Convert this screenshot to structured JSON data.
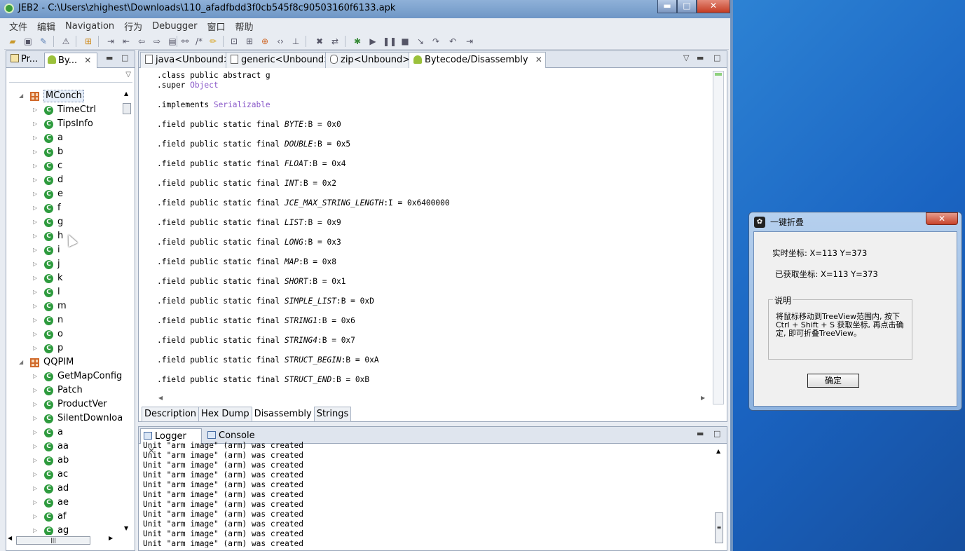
{
  "window": {
    "title": "JEB2 - C:\\Users\\zhighest\\Downloads\\110_afadfbdd3f0cb545f8c90503160f6133.apk",
    "minimize": "▬",
    "maximize": "□",
    "close": "✕"
  },
  "menu": [
    "文件",
    "编辑",
    "Navigation",
    "行为",
    "Debugger",
    "窗口",
    "帮助"
  ],
  "left_panel": {
    "tabs": [
      {
        "label": "Pr...",
        "icon": "project-icon"
      },
      {
        "label": "By...",
        "icon": "android-icon",
        "close": "✕"
      }
    ],
    "tree": [
      {
        "type": "package",
        "label": "MConch",
        "expanded": true,
        "selected": true
      },
      {
        "type": "class",
        "label": "TimeCtrl"
      },
      {
        "type": "class",
        "label": "TipsInfo"
      },
      {
        "type": "class",
        "label": "a"
      },
      {
        "type": "class",
        "label": "b"
      },
      {
        "type": "class",
        "label": "c"
      },
      {
        "type": "class",
        "label": "d"
      },
      {
        "type": "class",
        "label": "e"
      },
      {
        "type": "class",
        "label": "f"
      },
      {
        "type": "class",
        "label": "g"
      },
      {
        "type": "class",
        "label": "h"
      },
      {
        "type": "class",
        "label": "i"
      },
      {
        "type": "class",
        "label": "j"
      },
      {
        "type": "class",
        "label": "k"
      },
      {
        "type": "class",
        "label": "l"
      },
      {
        "type": "class",
        "label": "m"
      },
      {
        "type": "class",
        "label": "n"
      },
      {
        "type": "class",
        "label": "o"
      },
      {
        "type": "class",
        "label": "p"
      },
      {
        "type": "package",
        "label": "QQPIM",
        "expanded": true
      },
      {
        "type": "class",
        "label": "GetMapConfig"
      },
      {
        "type": "class",
        "label": "Patch"
      },
      {
        "type": "class",
        "label": "ProductVer"
      },
      {
        "type": "class",
        "label": "SilentDownloa"
      },
      {
        "type": "class",
        "label": "a"
      },
      {
        "type": "class",
        "label": "aa"
      },
      {
        "type": "class",
        "label": "ab"
      },
      {
        "type": "class",
        "label": "ac"
      },
      {
        "type": "class",
        "label": "ad"
      },
      {
        "type": "class",
        "label": "ae"
      },
      {
        "type": "class",
        "label": "af"
      },
      {
        "type": "class",
        "label": "ag"
      }
    ]
  },
  "editor": {
    "tabs": [
      {
        "label": "java<Unbound>",
        "active": false
      },
      {
        "label": "generic<Unbound>",
        "active": false
      },
      {
        "label": "zip<Unbound>",
        "active": false
      },
      {
        "label": "Bytecode/Disassembly",
        "active": true,
        "close": "✕"
      }
    ],
    "code": [
      {
        "segments": [
          {
            "t": ".class public abstract g",
            "c": "kw"
          }
        ]
      },
      {
        "segments": [
          {
            "t": ".super ",
            "c": "kw"
          },
          {
            "t": "Object",
            "c": "ty"
          }
        ]
      },
      {
        "segments": []
      },
      {
        "segments": [
          {
            "t": ".implements ",
            "c": "kw"
          },
          {
            "t": "Serializable",
            "c": "ty"
          }
        ]
      },
      {
        "segments": []
      },
      {
        "segments": [
          {
            "t": ".field public static final ",
            "c": "kw"
          },
          {
            "t": "BYTE",
            "c": "fn"
          },
          {
            "t": ":B = 0x0",
            "c": "kw"
          }
        ]
      },
      {
        "segments": []
      },
      {
        "segments": [
          {
            "t": ".field public static final ",
            "c": "kw"
          },
          {
            "t": "DOUBLE",
            "c": "fn"
          },
          {
            "t": ":B = 0x5",
            "c": "kw"
          }
        ]
      },
      {
        "segments": []
      },
      {
        "segments": [
          {
            "t": ".field public static final ",
            "c": "kw"
          },
          {
            "t": "FLOAT",
            "c": "fn"
          },
          {
            "t": ":B = 0x4",
            "c": "kw"
          }
        ]
      },
      {
        "segments": []
      },
      {
        "segments": [
          {
            "t": ".field public static final ",
            "c": "kw"
          },
          {
            "t": "INT",
            "c": "fn"
          },
          {
            "t": ":B = 0x2",
            "c": "kw"
          }
        ]
      },
      {
        "segments": []
      },
      {
        "segments": [
          {
            "t": ".field public static final ",
            "c": "kw"
          },
          {
            "t": "JCE_MAX_STRING_LENGTH",
            "c": "fn"
          },
          {
            "t": ":I = 0x6400000",
            "c": "kw"
          }
        ]
      },
      {
        "segments": []
      },
      {
        "segments": [
          {
            "t": ".field public static final ",
            "c": "kw"
          },
          {
            "t": "LIST",
            "c": "fn"
          },
          {
            "t": ":B = 0x9",
            "c": "kw"
          }
        ]
      },
      {
        "segments": []
      },
      {
        "segments": [
          {
            "t": ".field public static final ",
            "c": "kw"
          },
          {
            "t": "LONG",
            "c": "fn"
          },
          {
            "t": ":B = 0x3",
            "c": "kw"
          }
        ]
      },
      {
        "segments": []
      },
      {
        "segments": [
          {
            "t": ".field public static final ",
            "c": "kw"
          },
          {
            "t": "MAP",
            "c": "fn"
          },
          {
            "t": ":B = 0x8",
            "c": "kw"
          }
        ]
      },
      {
        "segments": []
      },
      {
        "segments": [
          {
            "t": ".field public static final ",
            "c": "kw"
          },
          {
            "t": "SHORT",
            "c": "fn"
          },
          {
            "t": ":B = 0x1",
            "c": "kw"
          }
        ]
      },
      {
        "segments": []
      },
      {
        "segments": [
          {
            "t": ".field public static final ",
            "c": "kw"
          },
          {
            "t": "SIMPLE_LIST",
            "c": "fn"
          },
          {
            "t": ":B = 0xD",
            "c": "kw"
          }
        ]
      },
      {
        "segments": []
      },
      {
        "segments": [
          {
            "t": ".field public static final ",
            "c": "kw"
          },
          {
            "t": "STRING1",
            "c": "fn"
          },
          {
            "t": ":B = 0x6",
            "c": "kw"
          }
        ]
      },
      {
        "segments": []
      },
      {
        "segments": [
          {
            "t": ".field public static final ",
            "c": "kw"
          },
          {
            "t": "STRING4",
            "c": "fn"
          },
          {
            "t": ":B = 0x7",
            "c": "kw"
          }
        ]
      },
      {
        "segments": []
      },
      {
        "segments": [
          {
            "t": ".field public static final ",
            "c": "kw"
          },
          {
            "t": "STRUCT_BEGIN",
            "c": "fn"
          },
          {
            "t": ":B = 0xA",
            "c": "kw"
          }
        ]
      },
      {
        "segments": []
      },
      {
        "segments": [
          {
            "t": ".field public static final ",
            "c": "kw"
          },
          {
            "t": "STRUCT_END",
            "c": "fn"
          },
          {
            "t": ":B = 0xB",
            "c": "kw"
          }
        ]
      }
    ],
    "bottom_tabs": [
      {
        "label": "Description",
        "active": false
      },
      {
        "label": "Hex Dump",
        "active": false
      },
      {
        "label": "Disassembly",
        "active": true
      },
      {
        "label": "Strings",
        "active": false
      }
    ]
  },
  "console": {
    "tabs": [
      {
        "label": "Logger",
        "active": true,
        "close": "✕"
      },
      {
        "label": "Console",
        "active": false
      }
    ],
    "lines": [
      "Unit \"arm image\" (arm) was created",
      "Unit \"arm image\" (arm) was created",
      "Unit \"arm image\" (arm) was created",
      "Unit \"arm image\" (arm) was created",
      "Unit \"arm image\" (arm) was created",
      "Unit \"arm image\" (arm) was created",
      "Unit \"arm image\" (arm) was created",
      "Unit \"arm image\" (arm) was created",
      "Unit \"arm image\" (arm) was created",
      "Unit \"arm image\" (arm) was created",
      "Unit \"arm image\" (arm) was created"
    ]
  },
  "dialog": {
    "title": "一键折叠",
    "close": "✕",
    "realtime_coord": "实时坐标: X=113 Y=373",
    "acquired_coord": "已获取坐标: X=113 Y=373",
    "group_label": "说明",
    "description": "将鼠标移动到TreeView范围内, 按下Ctrl + Shift + S 获取坐标, 再点击确定, 即可折叠TreeView。",
    "ok_button": "确定"
  }
}
